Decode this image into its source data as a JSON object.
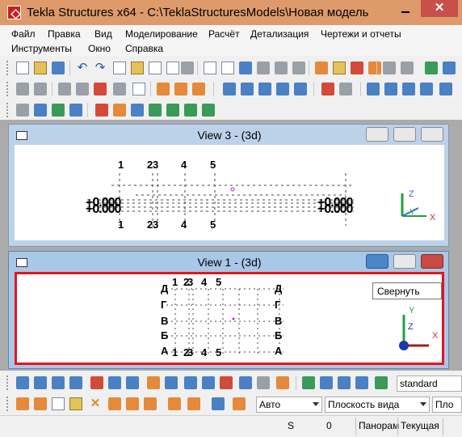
{
  "window": {
    "title": "Tekla Structures x64 - C:\\TeklaStructuresModels\\Новая модель",
    "close_glyph": "✕"
  },
  "menu": {
    "row1": [
      "Файл",
      "Правка",
      "Вид",
      "Моделирование",
      "Расчёт",
      "Детализация",
      "Чертежи и отчеты"
    ],
    "row2": [
      "Инструменты",
      "Окно",
      "Справка"
    ]
  },
  "view3": {
    "title": "View 3 - (3d)",
    "grid_top": [
      "1",
      "2",
      "3",
      "4",
      "5"
    ],
    "grid_bottom": [
      "1",
      "2",
      "3",
      "4",
      "5"
    ],
    "elevation_left": "+0.000",
    "elevation_right": "+0.000",
    "axis_labels": {
      "z": "Z",
      "y": "Y",
      "x": "X"
    }
  },
  "view1": {
    "title": "View 1 - (3d)",
    "grid_top": [
      "1",
      "2",
      "3",
      "4",
      "5"
    ],
    "grid_bottom": [
      "1",
      "2",
      "3",
      "4",
      "5"
    ],
    "rows_left": [
      "Д",
      "Г",
      "В",
      "Б",
      "А"
    ],
    "rows_right": [
      "Д",
      "Г",
      "В",
      "Б",
      "А"
    ],
    "axis_labels": {
      "z": "Z",
      "y": "Y",
      "x": "X"
    },
    "highlight_color": "#e5141c"
  },
  "tooltip": {
    "text": "Свернуть"
  },
  "toolbars": {
    "standard_select": "standard",
    "snap_select": "Авто",
    "plane_select": "Плоскость вида",
    "plane2_select": "Пло"
  },
  "statusbar": {
    "s_label": "S",
    "count": "0",
    "panorama": "Панорам",
    "current": "Текущая"
  }
}
